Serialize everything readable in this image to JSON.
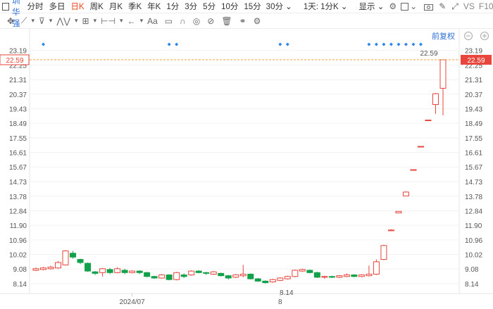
{
  "toolbar": {
    "symbol": "深圳华强",
    "timeframes": [
      {
        "label": "分时",
        "active": false
      },
      {
        "label": "多日",
        "active": false
      },
      {
        "label": "日K",
        "active": true
      },
      {
        "label": "周K",
        "active": false
      },
      {
        "label": "月K",
        "active": false
      },
      {
        "label": "季K",
        "active": false
      },
      {
        "label": "年K",
        "active": false
      },
      {
        "label": "1分",
        "active": false
      },
      {
        "label": "3分",
        "active": false
      },
      {
        "label": "5分",
        "active": false
      },
      {
        "label": "10分",
        "active": false
      },
      {
        "label": "15分",
        "active": false
      }
    ],
    "period_dropdown": "30分",
    "range_dropdown": "1天: 1分K",
    "display_dropdown": "显示",
    "vs_label": "VS",
    "f10_label": "F10"
  },
  "adjust_label": "前复权",
  "chart_data": {
    "type": "candlestick",
    "y_ticks": [
      23.19,
      22.25,
      21.31,
      20.37,
      19.43,
      18.49,
      17.55,
      16.61,
      15.67,
      14.73,
      13.78,
      12.84,
      11.9,
      10.96,
      10.02,
      9.08,
      8.14
    ],
    "ylim": [
      7.5,
      23.45
    ],
    "x_labels": [
      "2024/07",
      "8"
    ],
    "last_price": "22.59",
    "last_price_value": 22.59,
    "high_annotation": "22.59",
    "low_annotation": "8.14",
    "colors": {
      "up": "#e8453c",
      "down": "#12a14b",
      "price_line": "#f5a03c",
      "marker": "#2f86e6",
      "price_tag": "#e8453c"
    },
    "candles": [
      [
        9.0,
        9.1,
        8.95,
        9.18
      ],
      [
        9.05,
        9.15,
        9.0,
        9.22
      ],
      [
        9.1,
        9.2,
        9.05,
        9.3
      ],
      [
        9.15,
        9.5,
        9.1,
        9.6
      ],
      [
        9.35,
        10.25,
        9.3,
        10.3
      ],
      [
        10.1,
        9.85,
        9.75,
        10.25
      ],
      [
        9.7,
        9.5,
        9.4,
        9.75
      ],
      [
        9.45,
        8.95,
        8.9,
        9.5
      ],
      [
        8.9,
        8.8,
        8.7,
        8.95
      ],
      [
        8.85,
        9.1,
        8.6,
        9.15
      ],
      [
        9.05,
        8.85,
        8.75,
        9.15
      ],
      [
        8.85,
        9.1,
        8.8,
        9.2
      ],
      [
        9.0,
        8.85,
        8.75,
        9.1
      ],
      [
        8.85,
        8.95,
        8.8,
        9.0
      ],
      [
        8.95,
        8.85,
        8.75,
        9.0
      ],
      [
        8.85,
        8.6,
        8.55,
        8.9
      ],
      [
        8.6,
        8.5,
        8.45,
        8.65
      ],
      [
        8.5,
        8.7,
        8.45,
        8.75
      ],
      [
        8.7,
        8.4,
        8.35,
        8.75
      ],
      [
        8.4,
        8.85,
        8.35,
        8.9
      ],
      [
        8.7,
        8.6,
        8.5,
        8.8
      ],
      [
        8.7,
        8.95,
        8.65,
        9.0
      ],
      [
        8.95,
        8.85,
        8.8,
        9.0
      ],
      [
        8.85,
        8.8,
        8.7,
        8.9
      ],
      [
        8.75,
        8.9,
        8.7,
        8.95
      ],
      [
        8.8,
        8.65,
        8.6,
        8.85
      ],
      [
        8.65,
        8.5,
        8.4,
        8.7
      ],
      [
        8.55,
        8.7,
        8.5,
        8.75
      ],
      [
        8.65,
        8.75,
        8.55,
        9.35
      ],
      [
        8.75,
        8.45,
        8.4,
        8.8
      ],
      [
        8.45,
        8.3,
        8.25,
        8.5
      ],
      [
        8.3,
        8.2,
        8.14,
        8.35
      ],
      [
        8.25,
        8.4,
        8.2,
        8.45
      ],
      [
        8.35,
        8.5,
        8.3,
        8.55
      ],
      [
        8.45,
        8.6,
        8.4,
        8.65
      ],
      [
        8.6,
        9.0,
        8.55,
        9.05
      ],
      [
        8.95,
        9.05,
        8.9,
        9.1
      ],
      [
        9.0,
        8.85,
        8.8,
        9.05
      ],
      [
        8.85,
        8.55,
        8.5,
        8.9
      ],
      [
        8.55,
        8.6,
        8.45,
        8.65
      ],
      [
        8.6,
        8.55,
        8.5,
        8.65
      ],
      [
        8.55,
        8.65,
        8.5,
        8.7
      ],
      [
        8.6,
        8.7,
        8.55,
        8.8
      ],
      [
        8.7,
        8.6,
        8.55,
        8.75
      ],
      [
        8.6,
        8.7,
        8.55,
        8.75
      ],
      [
        8.65,
        8.75,
        8.6,
        9.3
      ],
      [
        8.75,
        9.55,
        8.7,
        9.7
      ],
      [
        9.7,
        10.6,
        9.65,
        10.65
      ],
      [
        11.55,
        11.6,
        11.55,
        11.65
      ],
      [
        12.7,
        12.8,
        12.7,
        12.8
      ],
      [
        13.8,
        14.05,
        13.8,
        14.1
      ],
      [
        15.45,
        15.5,
        15.45,
        15.5
      ],
      [
        17.0,
        17.0,
        17.0,
        17.0
      ],
      [
        18.7,
        18.7,
        18.7,
        18.7
      ],
      [
        19.7,
        20.4,
        19.1,
        20.45
      ],
      [
        20.75,
        22.59,
        19.0,
        22.59
      ]
    ],
    "marker_indices": [
      1,
      18,
      19,
      33,
      34,
      45,
      46,
      47,
      48,
      49,
      50,
      51,
      52
    ]
  }
}
